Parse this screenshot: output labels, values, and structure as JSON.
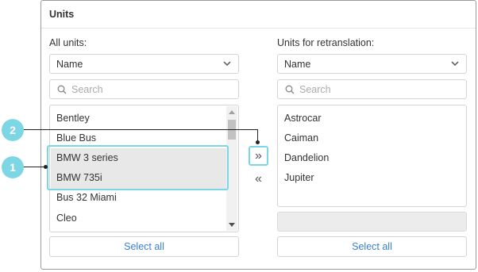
{
  "panel": {
    "title": "Units"
  },
  "left": {
    "label": "All units:",
    "sort_value": "Name",
    "search_placeholder": "Search",
    "items": [
      "Bentley",
      "Blue Bus",
      "BMW 3 series",
      "BMW 735i",
      "Bus 32 Miami",
      "Cleo"
    ],
    "selected_items": [
      "BMW 3 series",
      "BMW 735i"
    ],
    "select_all_label": "Select all"
  },
  "right": {
    "label": "Units for retranslation:",
    "sort_value": "Name",
    "search_placeholder": "Search",
    "items": [
      "Astrocar",
      "Caiman",
      "Dandelion",
      "Jupiter"
    ],
    "select_all_label": "Select all"
  },
  "buttons": {
    "move_right": "»",
    "move_left": "«"
  },
  "callouts": {
    "one": "1",
    "two": "2"
  },
  "colors": {
    "accent": "#7dd6e4",
    "link": "#3a7fd6",
    "selection": "#e8e8e8"
  },
  "icons": {
    "sort_dropdown": "chevron-down-icon",
    "search": "search-icon"
  }
}
